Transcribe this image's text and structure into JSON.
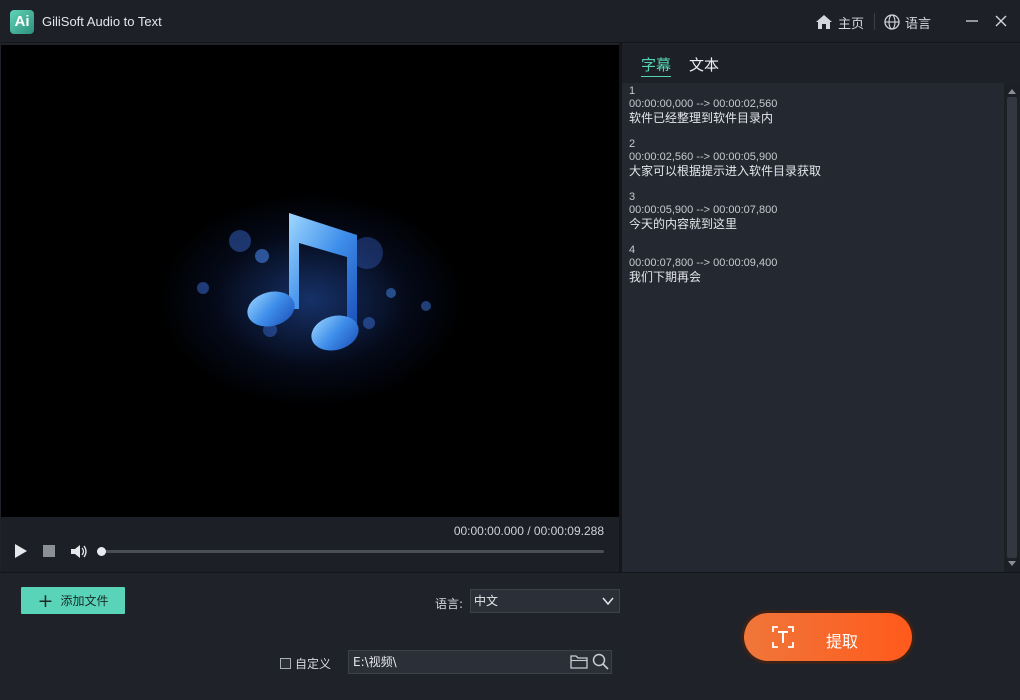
{
  "app": {
    "title": "GiliSoft Audio to Text",
    "logo_text": "Ai"
  },
  "titlebar": {
    "home_label": "主页",
    "language_label": "语言"
  },
  "player": {
    "time_current": "00:00:00.000",
    "time_separator": "/",
    "time_total": "00:00:09.288",
    "progress": 0
  },
  "panel": {
    "tabs": [
      {
        "label": "字幕",
        "active": true
      },
      {
        "label": "文本",
        "active": false
      }
    ],
    "subtitles": [
      {
        "index": "1",
        "time": "00:00:00,000 --> 00:00:02,560",
        "text": "软件已经整理到软件目录内"
      },
      {
        "index": "2",
        "time": "00:00:02,560 --> 00:00:05,900",
        "text": "大家可以根据提示进入软件目录获取"
      },
      {
        "index": "3",
        "time": "00:00:05,900 --> 00:00:07,800",
        "text": "今天的内容就到这里"
      },
      {
        "index": "4",
        "time": "00:00:07,800 --> 00:00:09,400",
        "text": "我们下期再会"
      }
    ]
  },
  "bottom": {
    "add_file_label": "添加文件",
    "language_label": "语言:",
    "language_value": "中文",
    "custom_label": "自定义",
    "custom_checked": false,
    "output_path": "E:\\视频\\",
    "extract_label": "提取"
  },
  "colors": {
    "accent": "#5ad4b9",
    "extract": "#ff5a1c",
    "background": "#1f2228"
  }
}
